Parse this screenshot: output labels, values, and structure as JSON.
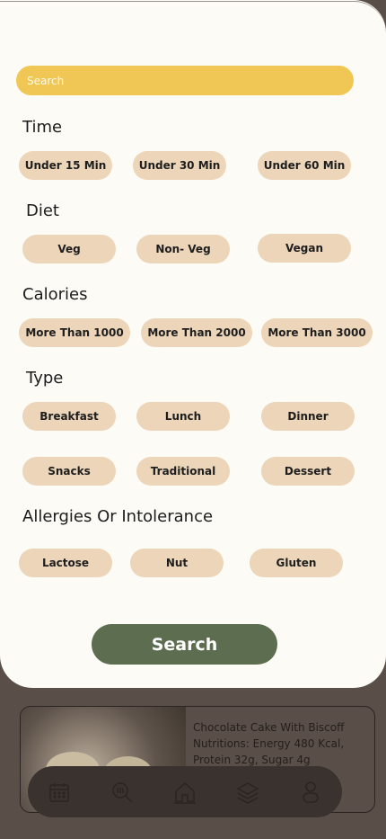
{
  "search": {
    "placeholder": "Search"
  },
  "sections": {
    "time": {
      "title": "Time",
      "options": [
        "Under 15 Min",
        "Under 30 Min",
        "Under 60 Min"
      ]
    },
    "diet": {
      "title": "Diet",
      "options": [
        "Veg",
        "Non- Veg",
        "Vegan"
      ]
    },
    "calories": {
      "title": "Calories",
      "options": [
        "More Than 1000",
        "More Than 2000",
        "More Than 3000"
      ]
    },
    "type": {
      "title": "Type",
      "options": [
        "Breakfast",
        "Lunch",
        "Dinner",
        "Snacks",
        "Traditional",
        "Dessert"
      ]
    },
    "allergies": {
      "title": "Allergies Or Intolerance",
      "options": [
        "Lactose",
        "Nut",
        "Gluten"
      ]
    }
  },
  "search_button": {
    "label": "Search"
  },
  "background_card": {
    "title": "Chocolate Cake With Biscoff",
    "nutrition_line1": "Nutritions: Energy 480 Kcal,",
    "nutrition_line2": "Protein 32g, Sugar 4g"
  },
  "bottom_nav": {
    "items": [
      "calendar-icon",
      "search-recipe-icon",
      "home-icon",
      "layers-icon",
      "profile-icon"
    ]
  },
  "colors": {
    "search_bar": "#f0c654",
    "chip": "#ecd5b8",
    "search_button": "#5c6e4f",
    "sheet": "#fdfbf6",
    "overlay": "#5a4e49"
  }
}
